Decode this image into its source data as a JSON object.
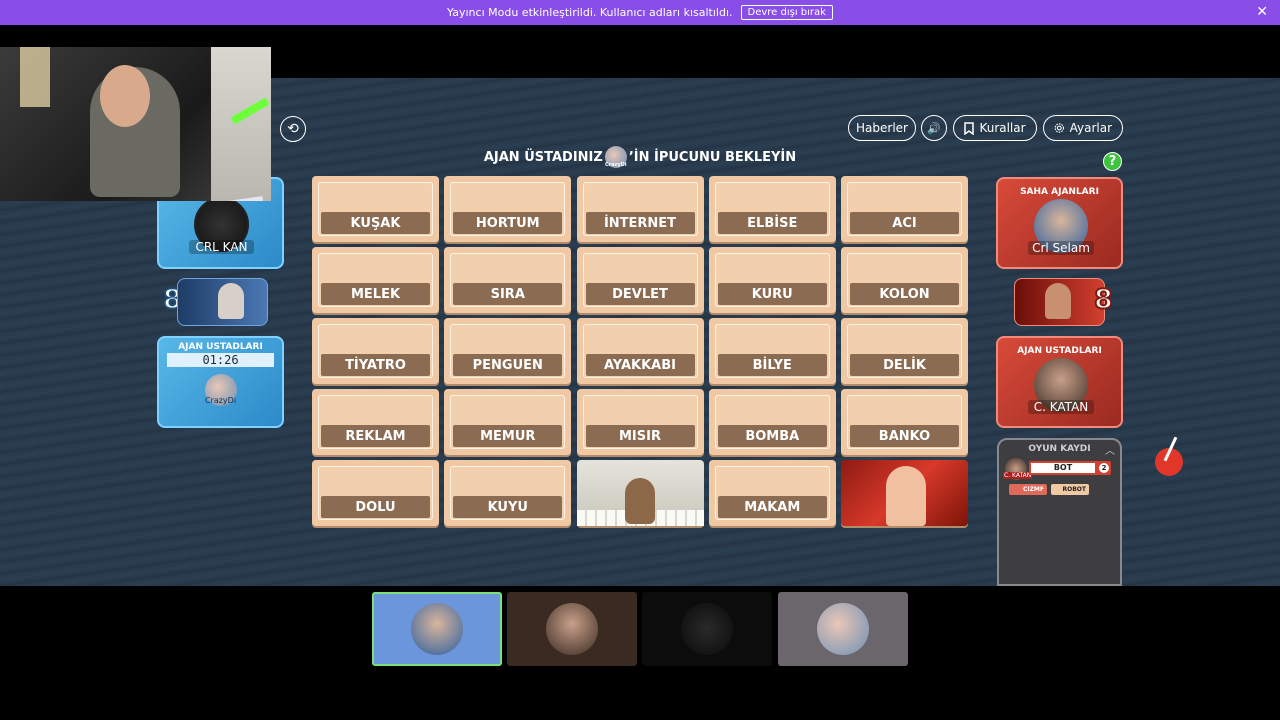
{
  "banner": {
    "message": "Yayıncı Modu etkinleştirildi. Kullanıcı adları kısaltıldı.",
    "disable_label": "Devre dışı bırak",
    "close": "✕"
  },
  "toolbar": {
    "news_label": "Haberler",
    "rules_label": "Kurallar",
    "settings_label": "Ayarlar",
    "sound_icon": "🔊",
    "undo_icon": "⟲",
    "help": "?"
  },
  "status": {
    "before": "AJAN ÜSTADINIZ",
    "avatar_name": "CrazyDi",
    "after": "’İN İPUCUNU BEKLEYİN"
  },
  "cards": [
    {
      "word": "KUŞAK",
      "state": "hidden"
    },
    {
      "word": "HORTUM",
      "state": "hidden"
    },
    {
      "word": "İNTERNET",
      "state": "hidden"
    },
    {
      "word": "ELBİSE",
      "state": "hidden"
    },
    {
      "word": "ACI",
      "state": "hidden"
    },
    {
      "word": "MELEK",
      "state": "hidden"
    },
    {
      "word": "SIRA",
      "state": "hidden"
    },
    {
      "word": "DEVLET",
      "state": "hidden"
    },
    {
      "word": "KURU",
      "state": "hidden"
    },
    {
      "word": "KOLON",
      "state": "hidden"
    },
    {
      "word": "TİYATRO",
      "state": "hidden"
    },
    {
      "word": "PENGUEN",
      "state": "hidden"
    },
    {
      "word": "AYAKKABI",
      "state": "hidden"
    },
    {
      "word": "BİLYE",
      "state": "hidden"
    },
    {
      "word": "DELİK",
      "state": "hidden"
    },
    {
      "word": "REKLAM",
      "state": "hidden"
    },
    {
      "word": "MEMUR",
      "state": "hidden"
    },
    {
      "word": "MISIR",
      "state": "hidden"
    },
    {
      "word": "BOMBA",
      "state": "hidden"
    },
    {
      "word": "BANKO",
      "state": "hidden"
    },
    {
      "word": "DOLU",
      "state": "hidden"
    },
    {
      "word": "KUYU",
      "state": "hidden"
    },
    {
      "word": "",
      "state": "neutral"
    },
    {
      "word": "MAKAM",
      "state": "hidden"
    },
    {
      "word": "",
      "state": "red"
    }
  ],
  "blue_team": {
    "operative_name": "CRL KAN",
    "score": "8",
    "spymaster_title": "AJAN USTADLARI",
    "timer": "01:26",
    "spymaster_name": "CrazyDi",
    "color": "#3fa7e0"
  },
  "red_team": {
    "operatives_title": "SAHA AJANLARI",
    "operative_name": "Crl Selam",
    "score": "8",
    "spymaster_title": "AJAN USTADLARI",
    "spymaster_name": "C. KATAN",
    "color": "#d2402f"
  },
  "log": {
    "title": "OYUN KAYDI",
    "entry_user": "C. KATAN",
    "entry_clue": "BOT",
    "entry_count": "2",
    "chip1": "CIZMF",
    "chip2": "ROBOT"
  }
}
